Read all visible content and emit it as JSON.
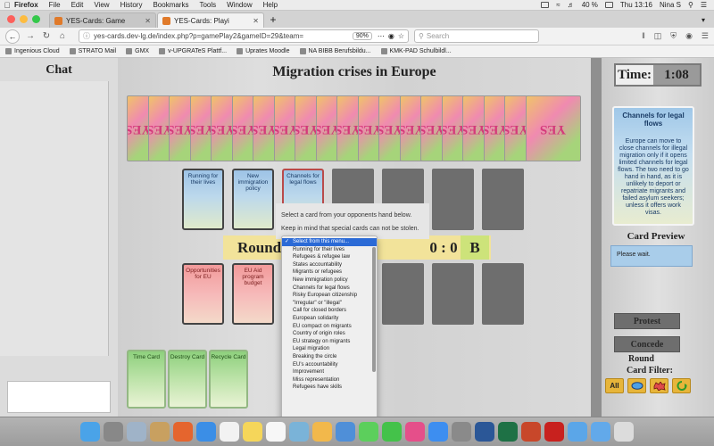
{
  "menubar": {
    "app": "Firefox",
    "items": [
      "File",
      "Edit",
      "View",
      "History",
      "Bookmarks",
      "Tools",
      "Window",
      "Help"
    ],
    "battery": "40 %",
    "clock": "Thu 13:16",
    "user": "Nina S"
  },
  "tabs": [
    {
      "title": "YES-Cards: Game",
      "active": false
    },
    {
      "title": "YES-Cards: Playi",
      "active": true
    }
  ],
  "nav": {
    "url": "yes-cards.dev-lg.de/index.php?p=gamePlay2&gameID=29&team=",
    "zoom": "90%",
    "search_placeholder": "Search"
  },
  "bookmarks": [
    "Ingenious Cloud",
    "STRATO Mail",
    "GMX",
    "v-UPGRATeS Plattf...",
    "Uprates Moodle",
    "NA BIBB Berufsbildu...",
    "KMK-PAD Schulbildl..."
  ],
  "chat": {
    "title": "Chat"
  },
  "board": {
    "title": "Migration crises in Europe",
    "deck_label": "YES",
    "opponent_cards": [
      {
        "label": "Running for their lives",
        "color": "blue"
      },
      {
        "label": "New immigration policy",
        "color": "blue"
      },
      {
        "label": "Channels for legal flows",
        "color": "blue",
        "selected": true
      }
    ],
    "player_cards": [
      {
        "label": "Opportunities for EU",
        "color": "red"
      },
      {
        "label": "EU Aid program budget",
        "color": "red"
      }
    ],
    "special_cards": [
      "Time Card",
      "Destroy Card",
      "Recycle Card"
    ],
    "round_label": "Round",
    "score": "0 : 0",
    "team_b": "B"
  },
  "steal_popup": {
    "line1": "Select a card from your opponents hand below.",
    "line2": "Keep in mind that special cards can not be stolen."
  },
  "steal_menu": {
    "selected": "Select from this menu...",
    "options": [
      "Select from this menu...",
      "Running for their lives",
      "Refugees & refugee law",
      "States accountability",
      "Migrants or refugees",
      "New immigration policy",
      "Channels for legal flows",
      "Risky European citizenship",
      "\"Irregular\" or \"illegal\"",
      "Call for closed borders",
      "European solidarity",
      "EU compact on migrants",
      "Country of origin roles",
      "EU strategy on migrants",
      "Legal migration",
      "Breaking the circle",
      "EU's accountability",
      "Improvement",
      "Miss representation",
      "Refugees have skills"
    ]
  },
  "right_panel": {
    "time_label": "Time:",
    "time_value": "1:08",
    "preview_card": {
      "title": "Channels for legal flows",
      "text": "Europe can move to close channels for illegal migration only if it opens limited channels for legal flows. The two need to go hand in hand, as it is unlikely to deport or repatriate migrants and failed asylum seekers; unless it offers work visas."
    },
    "card_preview_title": "Card Preview",
    "status": "Please wait.",
    "protest_label": "Protest",
    "concede_label": "Concede",
    "round_label": "Round",
    "filter_label": "Card Filter:",
    "filter_all": "All"
  }
}
